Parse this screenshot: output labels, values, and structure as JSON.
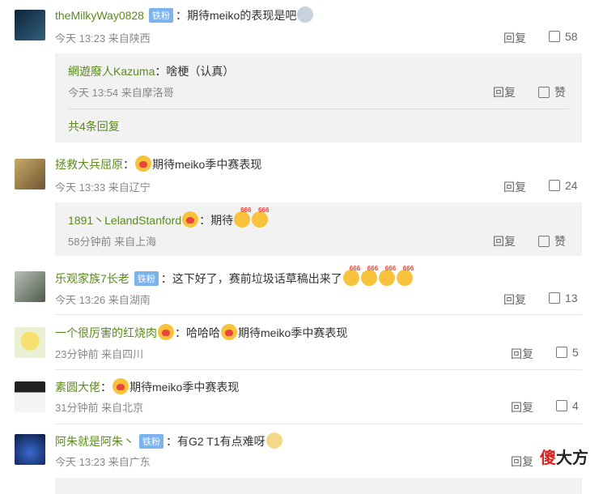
{
  "comments": [
    {
      "user": "theMilkyWay0828",
      "badge": "铁粉",
      "sep": "：",
      "text": "期待meiko的表现是吧",
      "meta": "今天 13:23 来自陕西",
      "reply": "回复",
      "likes": "58"
    },
    {
      "user": "拯救大兵屈原",
      "sep": "：",
      "text": "期待meiko季中赛表现",
      "meta": "今天 13:33 来自辽宁",
      "reply": "回复",
      "likes": "24"
    },
    {
      "user": "乐观家族7长老",
      "badge": "铁粉",
      "sep": "：",
      "text": "这下好了，赛前垃圾话草稿出来了",
      "meta": "今天 13:26 来自湖南",
      "reply": "回复",
      "likes": "13"
    },
    {
      "user": "一个很厉害的红烧肉",
      "sep": "：",
      "text_a": "哈哈哈",
      "text_b": "期待meiko季中赛表现",
      "meta": "23分钟前 来自四川",
      "reply": "回复",
      "likes": "5"
    },
    {
      "user": "素圆大佬",
      "sep": "：",
      "text": "期待meiko季中赛表现",
      "meta": "31分钟前 来自北京",
      "reply": "回复",
      "likes": "4"
    },
    {
      "user": "阿朱就是阿朱丶",
      "badge": "铁粉",
      "sep": "：",
      "text": "有G2 T1有点难呀",
      "meta": "今天 13:23 来自广东",
      "reply": "回复"
    }
  ],
  "subreplies": [
    {
      "user": "網遊廢人Kazuma",
      "sep": "：",
      "text": "啥梗（认真）",
      "meta": "今天 13:54 来自摩洛哥",
      "reply": "回复",
      "likes": "赞",
      "more": "共4条回复"
    },
    {
      "user": "1891丶LelandStanford",
      "sep": "：",
      "text": "期待",
      "meta": "58分钟前 来自上海",
      "reply": "回复",
      "likes": "赞"
    }
  ],
  "watermark": {
    "a": "傻",
    "b": "大方"
  }
}
